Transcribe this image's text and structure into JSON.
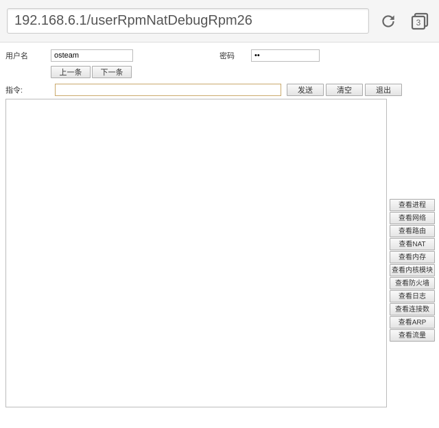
{
  "browser": {
    "url": "192.168.6.1/userRpmNatDebugRpm26",
    "tab_count": "3"
  },
  "credentials": {
    "user_label": "用户名",
    "user_value": "osteam",
    "pass_label": "密码",
    "pass_value": "**"
  },
  "nav": {
    "prev": "上一条",
    "next": "下一条"
  },
  "command": {
    "label": "指令:",
    "value": "",
    "send": "发送",
    "clear": "清空",
    "exit": "退出"
  },
  "side_buttons": [
    "查看进程",
    "查看网络",
    "查看路由",
    "查看NAT",
    "查看内存",
    "查看内核模块",
    "查看防火墙",
    "查看日志",
    "查看连接数",
    "查看ARP",
    "查看流量"
  ]
}
